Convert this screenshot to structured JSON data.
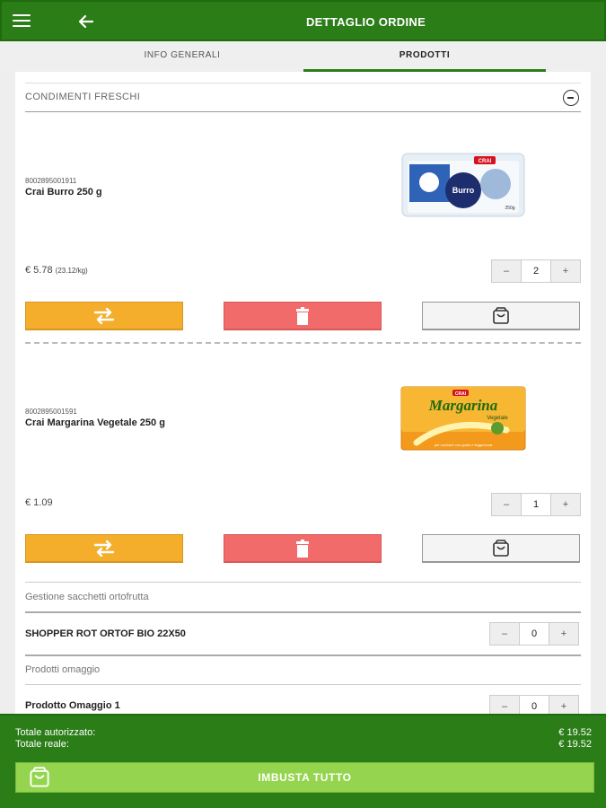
{
  "header": {
    "title": "DETTAGLIO ORDINE",
    "menu_icon": "hamburger-menu-icon",
    "back_icon": "arrow-left-icon"
  },
  "tabs": [
    {
      "label": "INFO GENERALI",
      "active": false
    },
    {
      "label": "PRODOTTI",
      "active": true
    }
  ],
  "section": {
    "label": "CONDIMENTI FRESCHI",
    "icon": "minus-circle-icon"
  },
  "products": [
    {
      "sku": "8002895001911",
      "name": "Crai Burro 250 g",
      "price": "€ 5.78",
      "unit_price": "(23.12/kg)",
      "quantity": "2",
      "image_label": "Burro",
      "image_brand": "CRAI",
      "image_weight": "250g"
    },
    {
      "sku": "8002895001591",
      "name": "Crai Margarina Vegetale 250 g",
      "price": "€ 1.09",
      "unit_price": "",
      "quantity": "1",
      "image_label": "Margarina",
      "image_brand": "CRAI",
      "image_sub": "Vegetale",
      "image_caption": "per cucinare con gusto e leggerezza"
    }
  ],
  "stepper": {
    "minus": "–",
    "plus": "+"
  },
  "bags_section": {
    "label": "Gestione sacchetti ortofrutta",
    "item": "SHOPPER ROT ORTOF BIO 22X50",
    "quantity": "0"
  },
  "gifts_section": {
    "label": "Prodotti omaggio",
    "item": "Prodotto Omaggio 1",
    "quantity": "0"
  },
  "totals": {
    "authorized_label": "Totale autorizzato:",
    "authorized_value": "€ 19.52",
    "real_label": "Totale reale:",
    "real_value": "€ 19.52"
  },
  "bag_all_button": "IMBUSTA TUTTO",
  "colors": {
    "primary": "#2b7d17",
    "swap": "#f5ae2c",
    "delete": "#f26b6b",
    "bag_all": "#95d44e"
  }
}
